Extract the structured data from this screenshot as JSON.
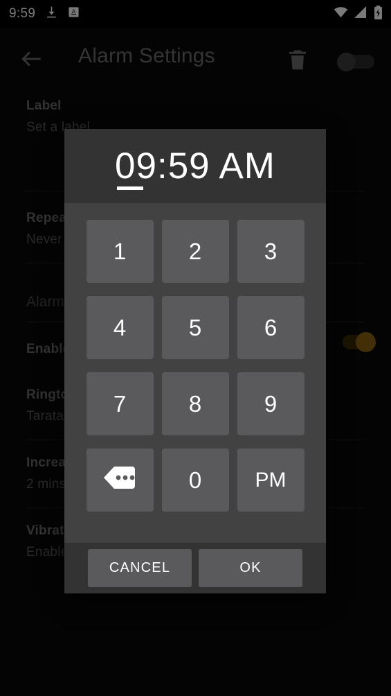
{
  "status_bar": {
    "time": "9:59",
    "left_icons": [
      "download-icon",
      "a-badge-icon"
    ],
    "right_icons": [
      "wifi-icon",
      "cellular-signal-icon",
      "battery-charging-icon"
    ]
  },
  "app_bar": {
    "back_icon": "back-arrow-icon",
    "title": "Alarm Settings",
    "delete_icon": "trash-icon",
    "toggle_state": "off"
  },
  "settings": {
    "rows": [
      {
        "title": "Label",
        "sub": "Set a label",
        "toggle": null
      },
      {
        "title": "Repeat",
        "sub": "Never",
        "toggle": null
      }
    ],
    "section_header": "Alarm",
    "rows2": [
      {
        "title": "Enabled",
        "sub": "",
        "toggle": "on"
      },
      {
        "title": "Ringtone",
        "sub": "Tarata",
        "toggle": null
      },
      {
        "title": "Increase in volume",
        "sub": "2 mins",
        "toggle": null
      },
      {
        "title": "Vibrate",
        "sub": "Enabled",
        "toggle": null
      }
    ]
  },
  "dialog": {
    "time_value": "09:59 AM",
    "keys": [
      {
        "label": "1",
        "name": "key-1"
      },
      {
        "label": "2",
        "name": "key-2"
      },
      {
        "label": "3",
        "name": "key-3"
      },
      {
        "label": "4",
        "name": "key-4"
      },
      {
        "label": "5",
        "name": "key-5"
      },
      {
        "label": "6",
        "name": "key-6"
      },
      {
        "label": "7",
        "name": "key-7"
      },
      {
        "label": "8",
        "name": "key-8"
      },
      {
        "label": "9",
        "name": "key-9"
      },
      {
        "label": "",
        "name": "backspace-key"
      },
      {
        "label": "0",
        "name": "key-0"
      },
      {
        "label": "PM",
        "name": "pm-key"
      }
    ],
    "cancel_label": "CANCEL",
    "ok_label": "OK"
  },
  "colors": {
    "dialog_bg": "#424242",
    "dialog_header_bg": "#333333",
    "key_bg": "#5a5a5c",
    "accent_toggle": "#8a6310",
    "text_primary": "#ffffff"
  }
}
